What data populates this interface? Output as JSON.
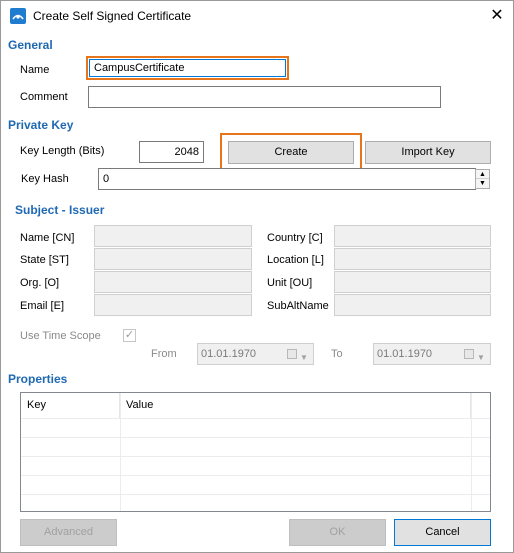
{
  "window": {
    "title": "Create Self Signed Certificate",
    "close_glyph": "✕"
  },
  "general": {
    "heading": "General",
    "name_label": "Name",
    "name_value": "CampusCertificate",
    "comment_label": "Comment",
    "comment_value": ""
  },
  "private_key": {
    "heading": "Private Key",
    "key_length_label": "Key Length (Bits)",
    "key_length_value": "2048",
    "create_label": "Create",
    "import_label": "Import Key",
    "key_hash_label": "Key Hash",
    "key_hash_value": "0"
  },
  "subject": {
    "heading": "Subject - Issuer",
    "left_labels": [
      "Name [CN]",
      "State [ST]",
      "Org. [O]",
      "Email [E]"
    ],
    "right_labels": [
      "Country [C]",
      "Location [L]",
      "Unit [OU]",
      "SubAltName"
    ]
  },
  "time_scope": {
    "label": "Use Time Scope",
    "checked": true,
    "from_label": "From",
    "from_value": "01.01.1970",
    "to_label": "To",
    "to_value": "01.01.1970"
  },
  "properties": {
    "heading": "Properties",
    "columns": [
      "Key",
      "Value"
    ]
  },
  "buttons": {
    "advanced": "Advanced",
    "ok": "OK",
    "cancel": "Cancel"
  },
  "colors": {
    "section_heading": "#1f69b3",
    "highlight": "#e8751a"
  }
}
